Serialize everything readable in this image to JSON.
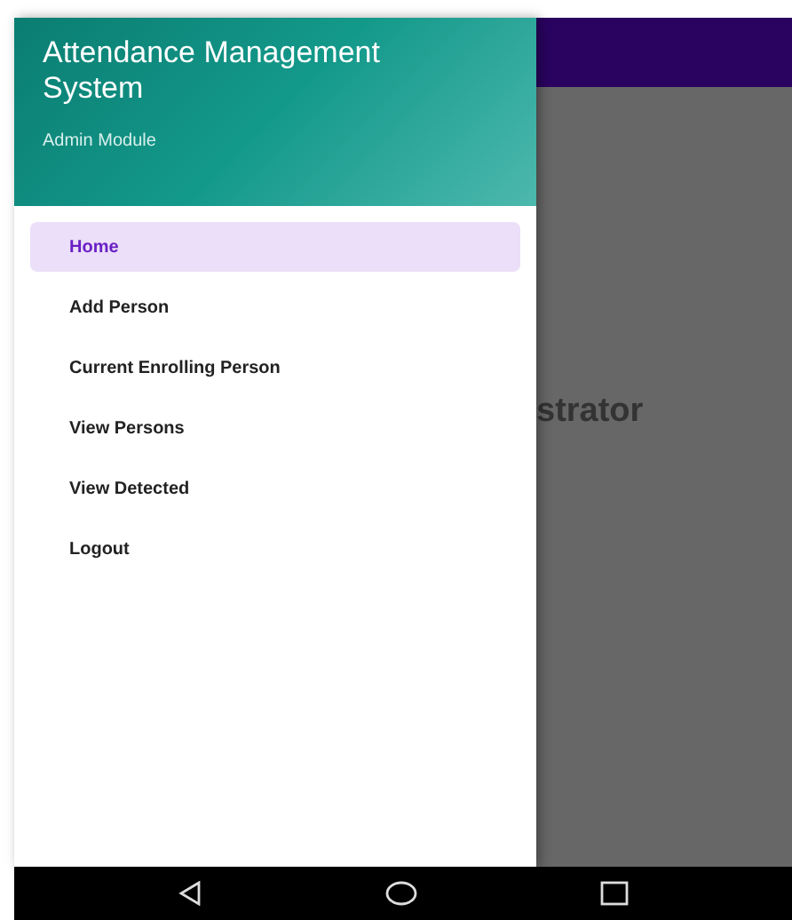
{
  "drawer": {
    "title": "Attendance Management System",
    "subtitle": "Admin Module",
    "items": [
      {
        "label": "Home",
        "selected": true
      },
      {
        "label": "Add Person",
        "selected": false
      },
      {
        "label": "Current Enrolling Person",
        "selected": false
      },
      {
        "label": "View Persons",
        "selected": false
      },
      {
        "label": "View Detected",
        "selected": false
      },
      {
        "label": "Logout",
        "selected": false
      }
    ]
  },
  "background": {
    "heading": "strator"
  }
}
